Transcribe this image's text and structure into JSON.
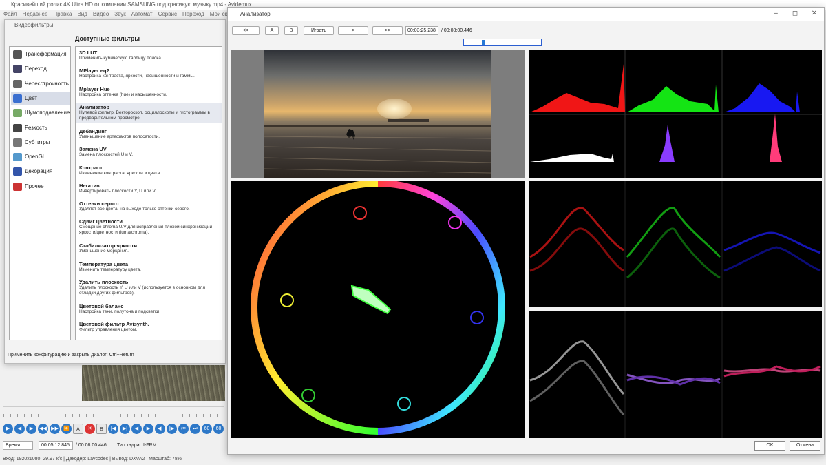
{
  "main": {
    "title": "Красивейший ролик 4K Ultra HD от компании SAMSUNG под красивую музыку.mp4 - Avidemux",
    "menu": [
      "Файл",
      "Недавнее",
      "Правка",
      "Вид",
      "Видео",
      "Звук",
      "Автомат",
      "Сервис",
      "Переход",
      "Мои ск"
    ],
    "time_label": "Время:",
    "time_value": "00:05:12.845",
    "time_total": "/ 00:08:00.446",
    "frame_type_label": "Тип кадра:",
    "frame_type": "I-FRM",
    "status": "Вход: 1920x1080, 29.97 к/с  |  Декодер: Lavcodec  |  Вывод: DXVA2  |  Масштаб: 78%"
  },
  "filters_dialog": {
    "title": "Видеофильтры",
    "available_header": "Доступные фильтры",
    "categories": [
      {
        "label": "Трансформация",
        "icon": "transform-icon",
        "color": "#555"
      },
      {
        "label": "Переход",
        "icon": "transition-icon",
        "color": "#446"
      },
      {
        "label": "Чересстрочность",
        "icon": "interlace-icon",
        "color": "#666"
      },
      {
        "label": "Цвет",
        "icon": "color-icon",
        "color": "#3a6fd0",
        "selected": true
      },
      {
        "label": "Шумоподавление",
        "icon": "denoise-icon",
        "color": "#7a6"
      },
      {
        "label": "Резкость",
        "icon": "sharpness-icon",
        "color": "#444"
      },
      {
        "label": "Субтитры",
        "icon": "subtitles-icon",
        "color": "#777"
      },
      {
        "label": "OpenGL",
        "icon": "opengl-icon",
        "color": "#59c"
      },
      {
        "label": "Декорация",
        "icon": "decoration-icon",
        "color": "#35a"
      },
      {
        "label": "Прочее",
        "icon": "other-icon",
        "color": "#c33"
      }
    ],
    "filters": [
      {
        "name": "3D LUT",
        "desc": "Применить кубическую таблицу поиска."
      },
      {
        "name": "MPlayer eq2",
        "desc": "Настройка контраста, яркости, насыщенности и гаммы."
      },
      {
        "name": "Mplayer Hue",
        "desc": "Настройка оттенка (hue) и насыщенности."
      },
      {
        "name": "Анализатор",
        "desc": "Нулевой фильтр. Вектороскоп, осциллоскопы и гистограммы в предварительном просмотре.",
        "selected": true
      },
      {
        "name": "Дебандинг",
        "desc": "Уменьшение артефактов полосатости."
      },
      {
        "name": "Замена UV",
        "desc": "Замена плоскостей U и V."
      },
      {
        "name": "Контраст",
        "desc": "Изменение контраста, яркости и цвета."
      },
      {
        "name": "Негатив",
        "desc": "Инвертировать плоскости Y, U или V"
      },
      {
        "name": "Оттенки серого",
        "desc": "Удаляет все цвета, на выходе только оттенки серого."
      },
      {
        "name": "Сдвиг цветности",
        "desc": "Смещение chroma U/V для исправления плохой синхронизации яркости/цветности (luma/chroma)."
      },
      {
        "name": "Стабилизатор яркости",
        "desc": "Уменьшение мерцания."
      },
      {
        "name": "Температура цвета",
        "desc": "Изменить температуру цвета."
      },
      {
        "name": "Удалить плоскость",
        "desc": "Удалить плоскость Y, U или V (используется в основном для отладки других фильтров)."
      },
      {
        "name": "Цветовой баланс",
        "desc": "Настройка тени, полутона и подсветки."
      },
      {
        "name": "Цветовой фильтр Avisynth.",
        "desc": "Фильтр управления цветом."
      }
    ],
    "hint": "Применить конфигурацию и закрыть диалог: Ctrl+Return"
  },
  "analyzer": {
    "title": "Анализатор",
    "buttons": {
      "rewind": "<<",
      "a": "A",
      "b": "B",
      "play": "Играть",
      "next": ">",
      "ff": ">>"
    },
    "time": "00:03:25.238",
    "total": "/ 00:08:00.446",
    "position": 0.43,
    "ok": "OK",
    "cancel": "Отмена"
  }
}
